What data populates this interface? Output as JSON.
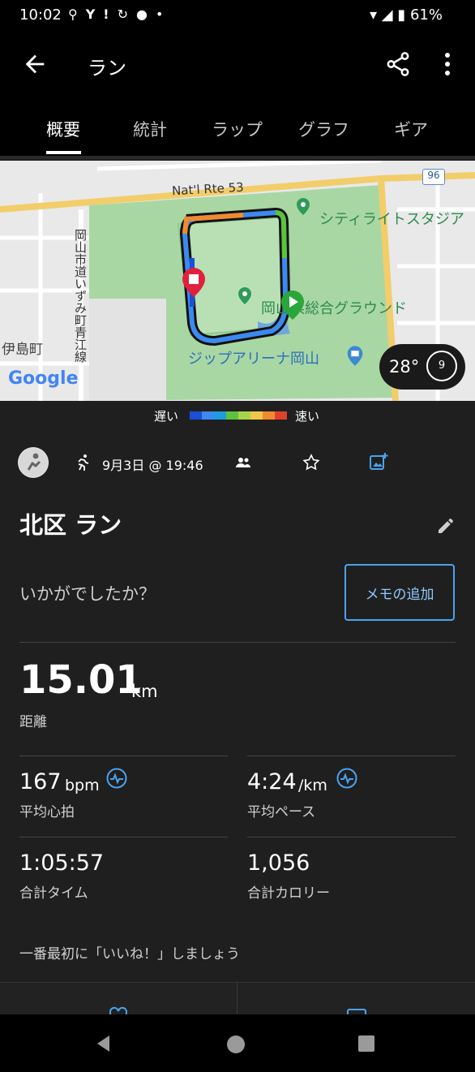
{
  "status_bar": {
    "time": "10:02",
    "battery": "61%",
    "icons": [
      "bicycle-icon",
      "yahoo-icon",
      "sync-icon",
      "line-icon",
      "dot-icon"
    ]
  },
  "app_bar": {
    "title": "ラン"
  },
  "tabs": [
    {
      "label": "概要",
      "active": true
    },
    {
      "label": "統計",
      "active": false
    },
    {
      "label": "ラップ",
      "active": false
    },
    {
      "label": "グラフ",
      "active": false
    },
    {
      "label": "ギア",
      "active": false
    }
  ],
  "map": {
    "road_label": "Nat'l Rte 53",
    "route_badge": "96",
    "place_1": "シティライトスタジア",
    "place_2": "岡山県総合グラウンド",
    "place_3": "ジップアリーナ岡山",
    "street_vertical": "岡山市道いずみ町青江線",
    "area_left": "伊島町",
    "provider": "Google",
    "temperature": "28°",
    "weather_badge": "9"
  },
  "legend": {
    "slow": "遅い",
    "fast": "速い",
    "colors": [
      "#1a4fd6",
      "#3c8af0",
      "#1f9be0",
      "#5cc33a",
      "#a7d44c",
      "#f0c64a",
      "#f08a30",
      "#e0412b"
    ]
  },
  "activity": {
    "date": "9月3日 @ 19:46",
    "title": "北区 ラン",
    "prompt": "いかがでしたか？",
    "memo_button": "メモの追加"
  },
  "stats": {
    "distance": {
      "value": "15.01",
      "unit": "km",
      "label": "距離"
    },
    "heart_rate": {
      "value": "167",
      "unit": "bpm",
      "label": "平均心拍"
    },
    "pace": {
      "value": "4:24",
      "unit": "/km",
      "label": "平均ペース"
    },
    "time": {
      "value": "1:05:57",
      "label": "合計タイム"
    },
    "calories": {
      "value": "1,056",
      "label": "合計カロリー"
    }
  },
  "footer": {
    "like_prompt": "一番最初に「いいね！」しましょう"
  }
}
